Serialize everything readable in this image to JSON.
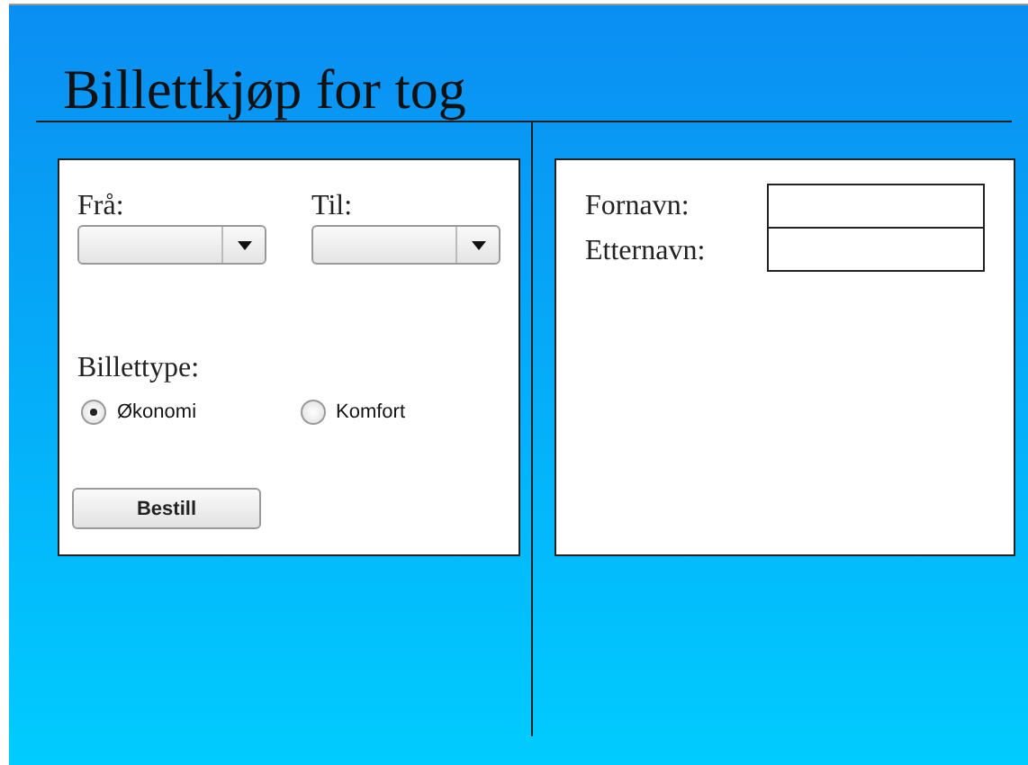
{
  "title": "Billettkjøp for tog",
  "route": [
    {
      "label": "Frå:"
    },
    {
      "label": "Til:"
    }
  ],
  "ticket_type": {
    "label": "Billettype:",
    "options": [
      {
        "label": "Økonomi",
        "selected": true
      },
      {
        "label": "Komfort",
        "selected": false
      }
    ]
  },
  "order_button": "Bestill",
  "passenger": [
    {
      "label": "Fornavn:"
    },
    {
      "label": "Etternavn:"
    }
  ]
}
